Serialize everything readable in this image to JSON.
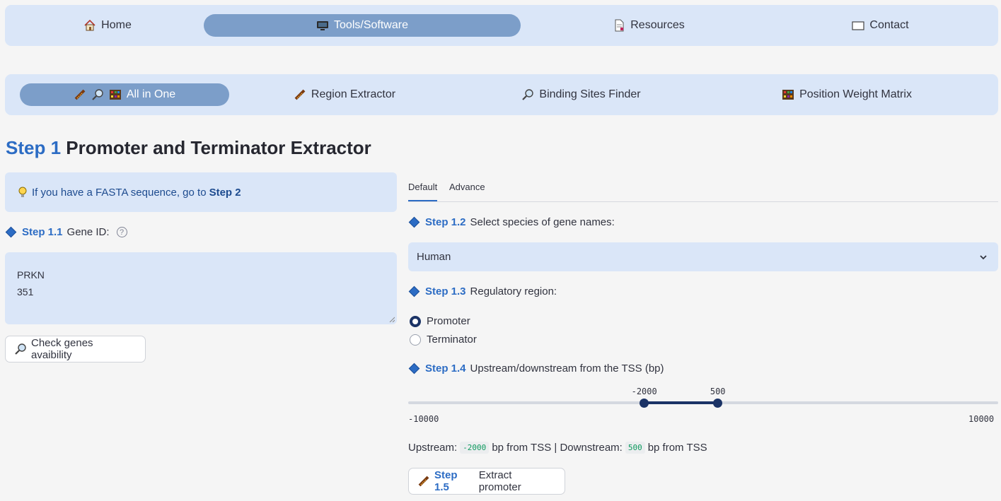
{
  "nav": {
    "items": [
      {
        "label": "Home",
        "icon": "house-icon"
      },
      {
        "label": "Tools/Software",
        "icon": "monitor-icon",
        "active": true
      },
      {
        "label": "Resources",
        "icon": "document-icon"
      },
      {
        "label": "Contact",
        "icon": "envelope-icon"
      }
    ]
  },
  "subnav": {
    "items": [
      {
        "label": "All in One",
        "active": true
      },
      {
        "label": "Region Extractor"
      },
      {
        "label": "Binding Sites Finder"
      },
      {
        "label": "Position Weight Matrix"
      }
    ]
  },
  "page": {
    "title_step": "Step 1",
    "title_text": "Promoter and Terminator Extractor"
  },
  "info": {
    "text": "If you have a FASTA sequence, go to",
    "link": "Step 2"
  },
  "step11": {
    "step": "Step 1.1",
    "label": "Gene ID:",
    "help": "?"
  },
  "gene_ids": {
    "line1": "PRKN",
    "line2": "351"
  },
  "check_button": {
    "label": "Check genes avaibility"
  },
  "tabs": {
    "default": "Default",
    "advance": "Advance"
  },
  "step12": {
    "step": "Step 1.2",
    "label": "Select species of gene names:"
  },
  "species": {
    "value": "Human"
  },
  "step13": {
    "step": "Step 1.3",
    "label": "Regulatory region:"
  },
  "regions": {
    "promoter": "Promoter",
    "terminator": "Terminator",
    "selected": "Promoter"
  },
  "step14": {
    "step": "Step 1.4",
    "label": "Upstream/downstream from the TSS (bp)"
  },
  "slider": {
    "min": -10000,
    "max": 10000,
    "low": -2000,
    "high": 500,
    "min_label": "-10000",
    "max_label": "10000",
    "low_label": "-2000",
    "high_label": "500"
  },
  "summary": {
    "up_label": "Upstream:",
    "up_value": "-2000",
    "up_suffix": "bp from TSS | Downstream:",
    "down_value": "500",
    "down_suffix": "bp from TSS"
  },
  "step15": {
    "step": "Step 1.5",
    "label": "Extract promoter"
  },
  "colors": {
    "accent": "#2c6cc4",
    "panel": "#dae6f8",
    "active_pill": "#7c9ec9",
    "slider": "#1b3366"
  }
}
